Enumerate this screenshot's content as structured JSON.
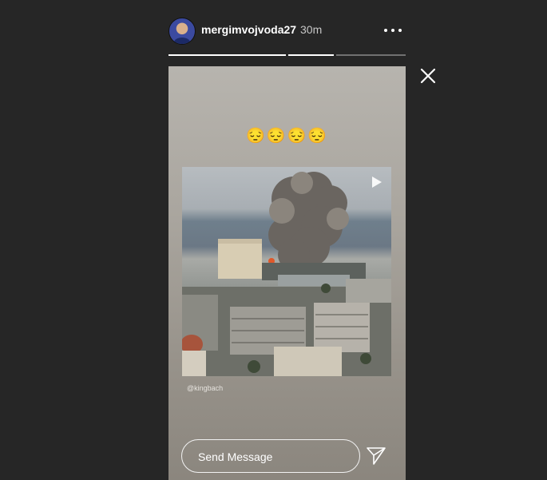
{
  "header": {
    "username": "mergimvojvoda27",
    "time_ago": "30m",
    "more_icon": "more-horizontal-icon"
  },
  "progress": [
    {
      "fill": 1.0
    },
    {
      "fill": 1.0
    },
    {
      "fill": 0.0
    }
  ],
  "story": {
    "caption_emojis": "😔😔😔😔",
    "video_credit": "@kingbach",
    "play_icon": "play-icon"
  },
  "reply": {
    "placeholder": "Send Message",
    "send_icon": "send-icon"
  },
  "close_icon": "close-icon",
  "colors": {
    "background": "#262626",
    "text": "#ffffff",
    "muted": "#c7c7c7"
  }
}
